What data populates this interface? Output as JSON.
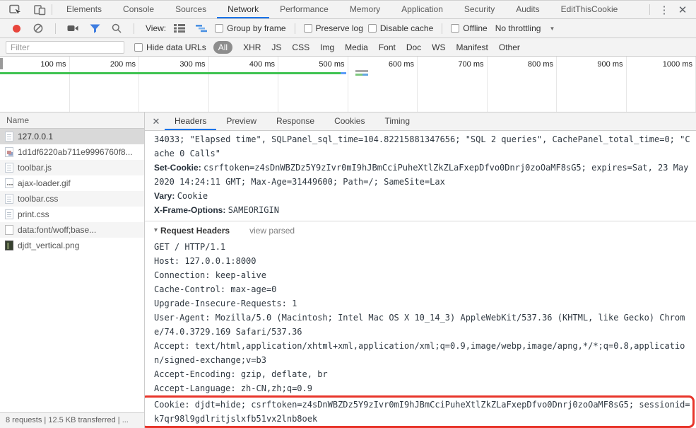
{
  "colors": {
    "accent_blue": "#1a73e8",
    "record_red": "#e8453c",
    "load_event_green": "#3fc351",
    "dom_event_blue": "#5b9cf8",
    "highlight_red": "#e8352a",
    "filter_funnel_blue": "#3f7de0",
    "toolbar_background": "#f3f3f3"
  },
  "main_tabs": {
    "items": [
      {
        "label": "Elements"
      },
      {
        "label": "Console"
      },
      {
        "label": "Sources"
      },
      {
        "label": "Network",
        "active": true
      },
      {
        "label": "Performance"
      },
      {
        "label": "Memory"
      },
      {
        "label": "Application"
      },
      {
        "label": "Security"
      },
      {
        "label": "Audits"
      },
      {
        "label": "EditThisCookie"
      }
    ]
  },
  "window_controls": {
    "menu_icon": "⋮",
    "close_icon": "✕"
  },
  "network_toolbar": {
    "view_label": "View:",
    "group_by_frame": "Group by frame",
    "preserve_log": "Preserve log",
    "disable_cache": "Disable cache",
    "offline": "Offline",
    "throttling": "No throttling",
    "throttling_arrow": "▼"
  },
  "filter_bar": {
    "placeholder": "Filter",
    "hide_data_urls": "Hide data URLs",
    "types": [
      {
        "label": "All",
        "active": true
      },
      {
        "label": "XHR"
      },
      {
        "label": "JS"
      },
      {
        "label": "CSS"
      },
      {
        "label": "Img"
      },
      {
        "label": "Media"
      },
      {
        "label": "Font"
      },
      {
        "label": "Doc"
      },
      {
        "label": "WS"
      },
      {
        "label": "Manifest"
      },
      {
        "label": "Other"
      }
    ]
  },
  "timeline": {
    "ticks": [
      "100 ms",
      "200 ms",
      "300 ms",
      "400 ms",
      "500 ms",
      "600 ms",
      "700 ms",
      "800 ms",
      "900 ms",
      "1000 ms"
    ]
  },
  "requests": {
    "column_header": "Name",
    "rows": [
      {
        "label": "127.0.0.1",
        "icon": "document-icon",
        "selected": true
      },
      {
        "label": "1d1df6220ab711e9996760f8...",
        "icon": "image-icon"
      },
      {
        "label": "toolbar.js",
        "icon": "document-icon"
      },
      {
        "label": "ajax-loader.gif",
        "icon": "image-dots-icon"
      },
      {
        "label": "toolbar.css",
        "icon": "document-icon"
      },
      {
        "label": "print.css",
        "icon": "document-icon"
      },
      {
        "label": "data:font/woff;base...",
        "icon": "plain-file-icon"
      },
      {
        "label": "djdt_vertical.png",
        "icon": "image-dark-icon"
      }
    ]
  },
  "details": {
    "close_icon": "✕",
    "tabs": [
      {
        "label": "Headers",
        "active": true
      },
      {
        "label": "Preview"
      },
      {
        "label": "Response"
      },
      {
        "label": "Cookies"
      },
      {
        "label": "Timing"
      }
    ],
    "response_tail": "34033; \"Elapsed time\", SQLPanel_sql_time=104.82215881347656; \"SQL 2 queries\", CachePanel_total_time=0; \"Cache 0 Calls\"",
    "response_headers": [
      {
        "name": "Set-Cookie",
        "value": "csrftoken=z4sDnWBZDz5Y9zIvr0mI9hJBmCciPuheXtlZkZLaFxepDfvo0Dnrj0zoOaMF8sG5; expires=Sat, 23 May 2020 14:24:11 GMT; Max-Age=31449600; Path=/; SameSite=Lax"
      },
      {
        "name": "Vary",
        "value": "Cookie"
      },
      {
        "name": "X-Frame-Options",
        "value": "SAMEORIGIN"
      }
    ],
    "request_section": {
      "disclosure": "▾",
      "title": "Request Headers",
      "view_parsed": "view parsed"
    },
    "request_lines": [
      {
        "text": "GET / HTTP/1.1"
      },
      {
        "text": "Host: 127.0.0.1:8000"
      },
      {
        "text": "Connection: keep-alive"
      },
      {
        "text": "Cache-Control: max-age=0"
      },
      {
        "text": "Upgrade-Insecure-Requests: 1"
      },
      {
        "text": "User-Agent: Mozilla/5.0 (Macintosh; Intel Mac OS X 10_14_3) AppleWebKit/537.36 (KHTML, like Gecko) Chrome/74.0.3729.169 Safari/537.36"
      },
      {
        "text": "Accept: text/html,application/xhtml+xml,application/xml;q=0.9,image/webp,image/apng,*/*;q=0.8,application/signed-exchange;v=b3"
      },
      {
        "text": "Accept-Encoding: gzip, deflate, br"
      },
      {
        "text": "Accept-Language: zh-CN,zh;q=0.9"
      },
      {
        "text": "Cookie: djdt=hide; csrftoken=z4sDnWBZDz5Y9zIvr0mI9hJBmCciPuheXtlZkZLaFxepDfvo0Dnrj0zoOaMF8sG5; sessionid=k7qr98l9gdlritjslxfb51vx2lnb8oek",
        "highlighted": true
      }
    ]
  },
  "status_bar": {
    "summary": "8 requests | 12.5 KB transferred | ..."
  }
}
